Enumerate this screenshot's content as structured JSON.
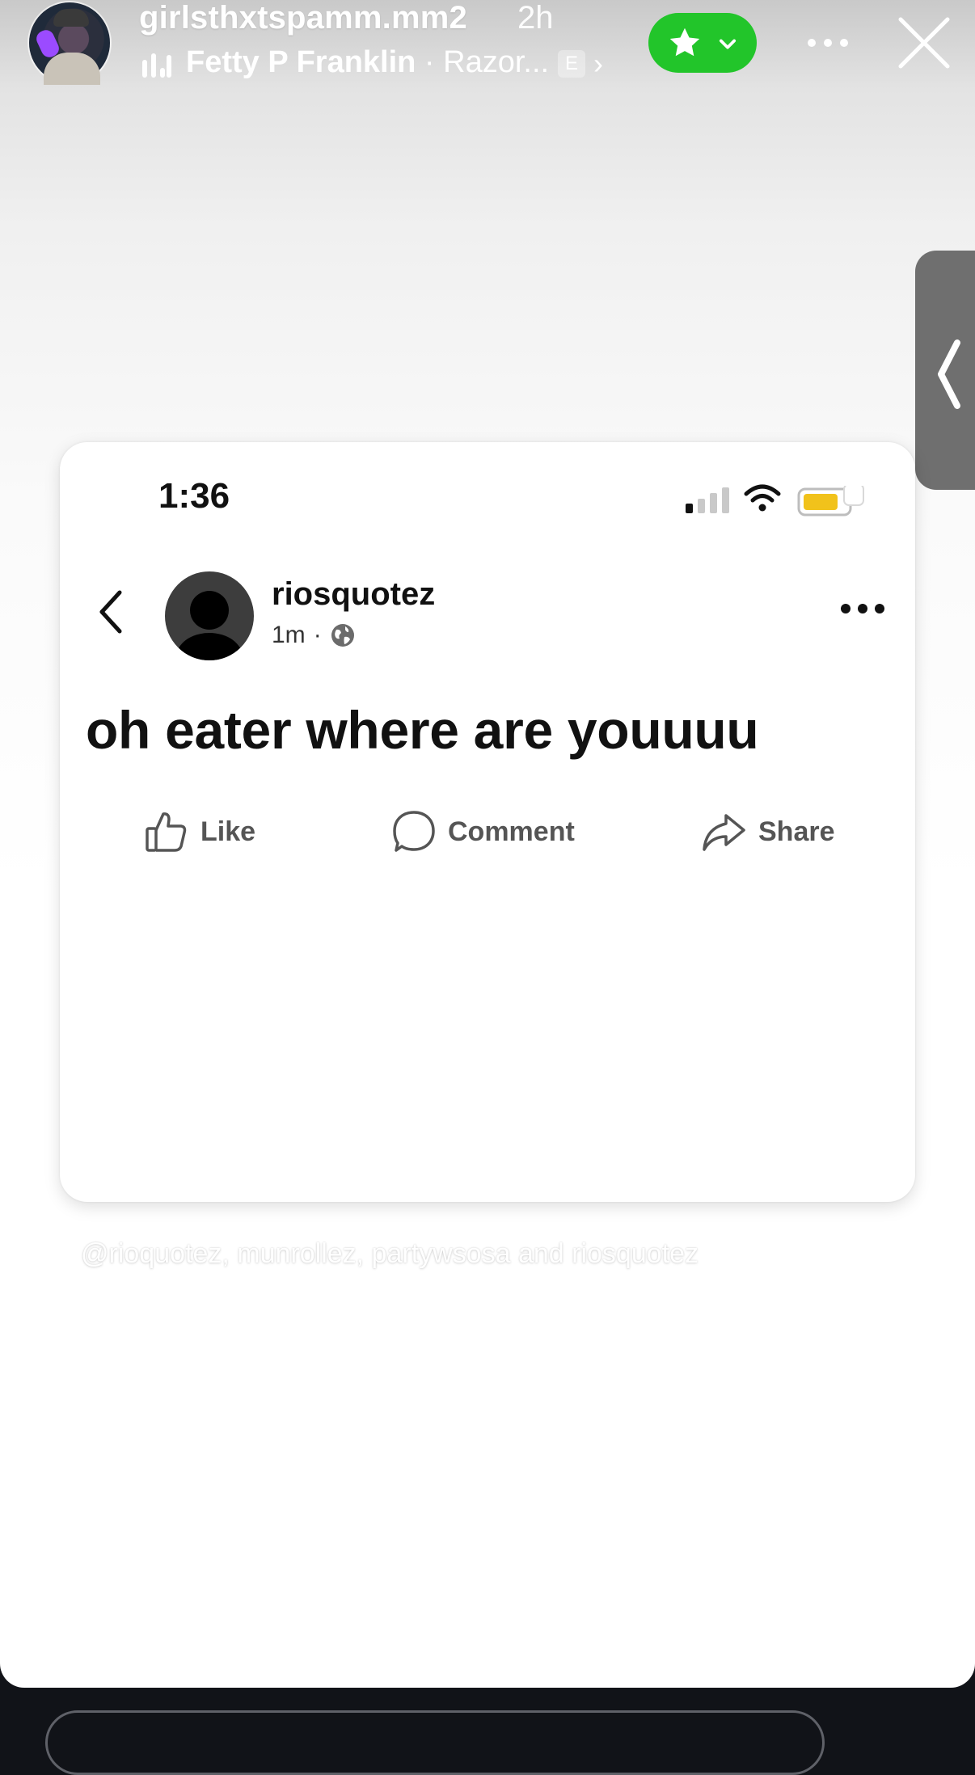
{
  "header": {
    "username": "girlsthxtspamm.mm2",
    "time_ago": "2h",
    "music": {
      "artist": "Fetty P Franklin",
      "separator": " · ",
      "track": "Razor...",
      "explicit_badge": "E"
    },
    "favorite_color": "#22c52a",
    "avatar_icon": "profile-photo",
    "close_icon": "close-icon",
    "more_icon": "more-horizontal-icon"
  },
  "side_tab": {
    "icon": "chevron-left-icon"
  },
  "post_card": {
    "status_time": "1:36",
    "poster_name": "riosquotez",
    "post_age": "1m",
    "meta_separator": "·",
    "post_text": "oh eater where are youuuu",
    "actions": {
      "like": "Like",
      "comment": "Comment",
      "share": "Share"
    },
    "battery_color": "#f1c21b"
  },
  "mentions": "@rioquotez, munrollez, partywsosa and riosquotez"
}
